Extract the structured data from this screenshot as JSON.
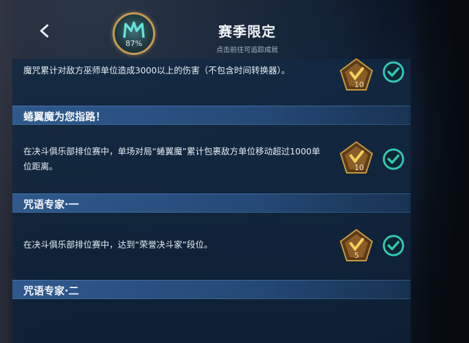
{
  "header": {
    "back_label": "",
    "progress_percent": "87%",
    "title": "赛季限定",
    "subtitle": "点击前往可追踪成就"
  },
  "achievements": [
    {
      "section_title": "",
      "description": "魔咒累计对敌方巫师单位造成3000以上的伤害（不包含时间转换器）。",
      "reward_count": "10",
      "completed": true
    },
    {
      "section_title": "蜷翼魔为您指路！",
      "description": "在决斗俱乐部排位赛中，单场对局“蜷翼魔”累计包裹敌方单位移动超过1000单位距离。",
      "reward_count": "10",
      "completed": true
    },
    {
      "section_title": "咒语专家·一",
      "description": "在决斗俱乐部排位赛中，达到“荣誉决斗家”段位。",
      "reward_count": "5",
      "completed": true
    },
    {
      "section_title": "咒语专家·二",
      "description": "",
      "reward_count": "",
      "completed": false
    }
  ],
  "colors": {
    "check_teal": "#33c7b4",
    "badge_gold": "#c99a3f",
    "header_bar": "#2f5d93"
  },
  "icons": {
    "back": "back-arrow-icon",
    "medallion": "m-emblem-icon",
    "badge": "pentagon-reward-badge-icon",
    "check": "check-circle-icon"
  }
}
